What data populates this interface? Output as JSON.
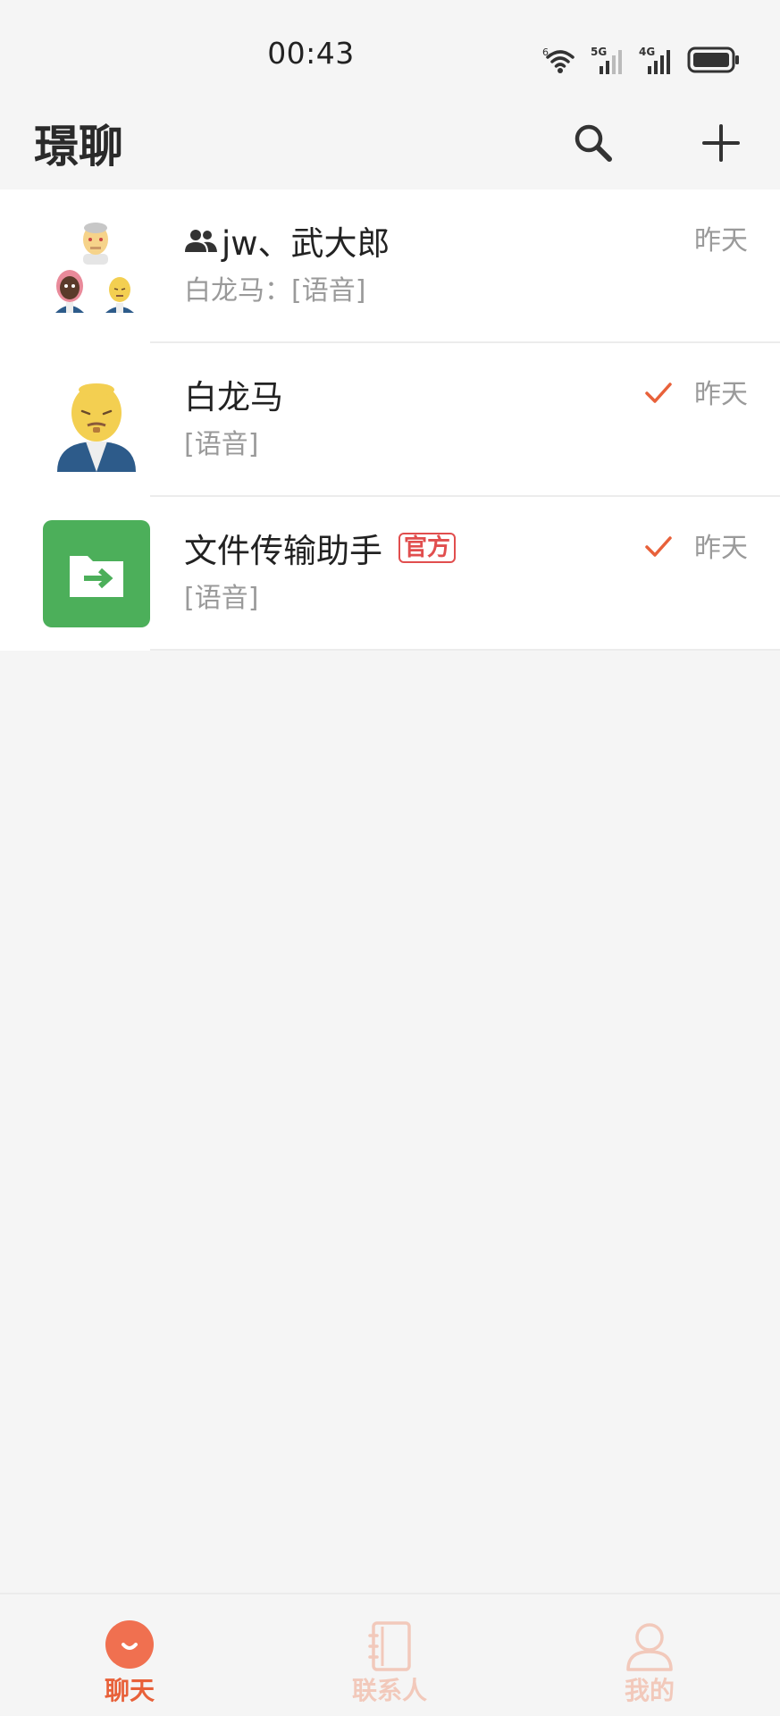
{
  "status_bar": {
    "time": "00:43",
    "wifi_badge": "6",
    "signal1_label": "5G",
    "signal2_label": "4G"
  },
  "header": {
    "title": "璟聊",
    "search_icon": "search-icon",
    "add_icon": "plus-icon"
  },
  "chats": [
    {
      "name": "jw、武大郎",
      "is_group": true,
      "preview": "白龙马：[语音]",
      "time": "昨天",
      "read_check": false
    },
    {
      "name": "白龙马",
      "is_group": false,
      "preview": "[语音]",
      "time": "昨天",
      "read_check": true
    },
    {
      "name": "文件传输助手",
      "badge": "官方",
      "is_group": false,
      "preview": "[语音]",
      "time": "昨天",
      "read_check": true
    }
  ],
  "bottom_nav": {
    "items": [
      {
        "label": "聊天",
        "icon": "chat-bubble-icon",
        "active": true
      },
      {
        "label": "联系人",
        "icon": "contacts-book-icon",
        "active": false
      },
      {
        "label": "我的",
        "icon": "person-icon",
        "active": false
      }
    ]
  },
  "colors": {
    "accent": "#e8613a",
    "inactive_nav": "#f2c9bb",
    "badge_red": "#e14e4e",
    "file_helper_green": "#4caf5a",
    "background": "#f5f5f5"
  }
}
